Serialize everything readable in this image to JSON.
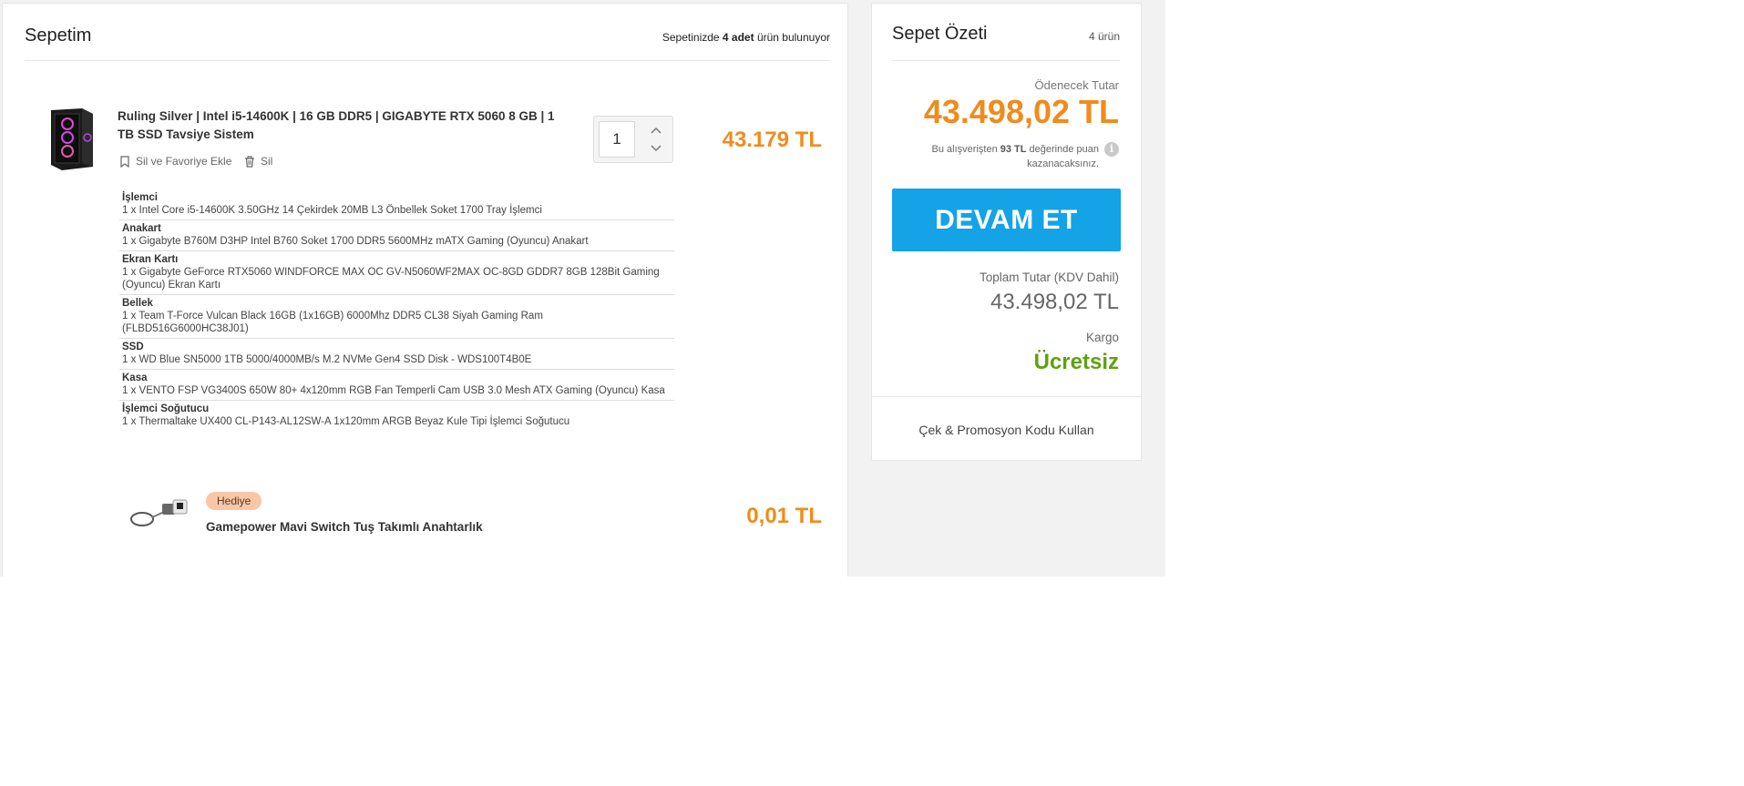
{
  "cart": {
    "title": "Sepetim",
    "count_prefix": "Sepetinizde ",
    "count_bold": "4 adet",
    "count_suffix": " ürün bulunuyor"
  },
  "product": {
    "title": "Ruling Silver | Intel i5-14600K | 16 GB DDR5 | GIGABYTE RTX 5060 8 GB | 1 TB SSD Tavsiye Sistem",
    "fav_label": "Sil ve Favoriye Ekle",
    "delete_label": "Sil",
    "quantity": "1",
    "price": "43.179 TL",
    "image_icon": "pc-case-icon",
    "components": [
      {
        "name": "İşlemci",
        "desc": "1 x Intel Core i5-14600K 3.50GHz 14 Çekirdek 20MB L3 Önbellek Soket 1700 Tray İşlemci"
      },
      {
        "name": "Anakart",
        "desc": "1 x Gigabyte B760M D3HP Intel B760 Soket 1700 DDR5 5600MHz mATX Gaming (Oyuncu) Anakart"
      },
      {
        "name": "Ekran Kartı",
        "desc": "1 x Gigabyte GeForce RTX5060 WINDFORCE MAX OC GV-N5060WF2MAX OC-8GD GDDR7 8GB 128Bit Gaming (Oyuncu) Ekran Kartı"
      },
      {
        "name": "Bellek",
        "desc": "1 x Team T-Force Vulcan Black 16GB (1x16GB) 6000Mhz DDR5 CL38 Siyah Gaming Ram (FLBD516G6000HC38J01)"
      },
      {
        "name": "SSD",
        "desc": "1 x WD Blue SN5000 1TB 5000/4000MB/s M.2 NVMe Gen4 SSD Disk - WDS100T4B0E"
      },
      {
        "name": "Kasa",
        "desc": "1 x VENTO FSP VG3400S 650W 80+ 4x120mm RGB Fan Temperli Cam USB 3.0 Mesh ATX Gaming (Oyuncu) Kasa"
      },
      {
        "name": "İşlemci Soğutucu",
        "desc": "1 x Thermaltake UX400 CL-P143-AL12SW-A 1x120mm ARGB Beyaz Kule Tipi İşlemci Soğutucu"
      }
    ]
  },
  "gift": {
    "badge": "Hediye",
    "name": "Gamepower Mavi Switch Tuş Takımlı Anahtarlık",
    "price": "0,01 TL",
    "image_icon": "keychain-icon"
  },
  "summary": {
    "title": "Sepet Özeti",
    "count": "4 ürün",
    "pay_label": "Ödenecek Tutar",
    "pay_amount": "43.498,02 TL",
    "points_prefix": "Bu alışverişten ",
    "points_bold": "93 TL",
    "points_suffix": " değerinde puan kazanacaksınız.",
    "continue_label": "DEVAM ET",
    "total_label": "Toplam Tutar (KDV Dahil)",
    "total_amount": "43.498,02 TL",
    "cargo_label": "Kargo",
    "cargo_value": "Ücretsiz",
    "promo_label": "Çek & Promosyon Kodu Kullan"
  },
  "colors": {
    "accent_orange": "#f18b1c",
    "button_blue": "#14a3e6",
    "free_green": "#5fa10e",
    "gift_badge": "#f9c6a8"
  }
}
